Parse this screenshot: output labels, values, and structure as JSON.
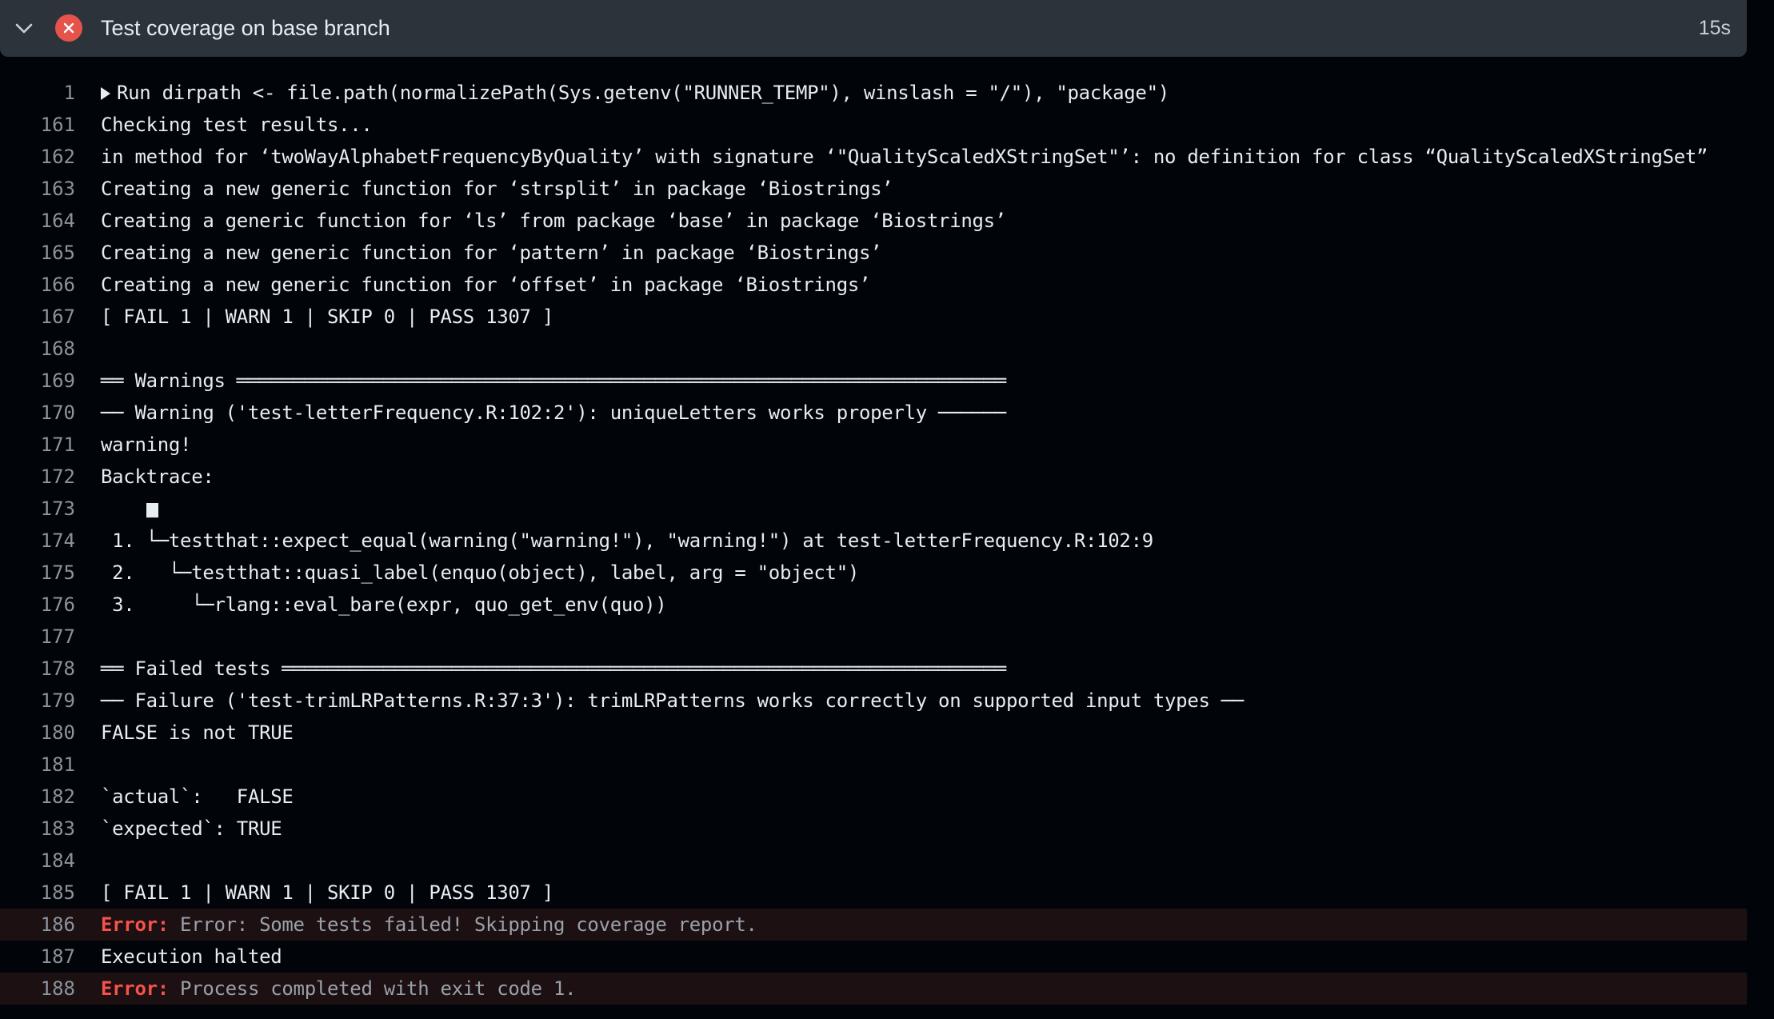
{
  "header": {
    "title": "Test coverage on base branch",
    "duration": "15s",
    "status": "failed",
    "status_color": "#e5534b",
    "expand_icon": "chevron-down-icon",
    "status_icon": "x-circle-icon"
  },
  "log": {
    "lines": [
      {
        "num": "1",
        "text": "Run dirpath <- file.path(normalizePath(Sys.getenv(\"RUNNER_TEMP\"), winslash = \"/\"), \"package\")",
        "collapsible": true
      },
      {
        "num": "161",
        "text": "Checking test results..."
      },
      {
        "num": "162",
        "text": "in method for ‘twoWayAlphabetFrequencyByQuality’ with signature ‘\"QualityScaledXStringSet\"’: no definition for class “QualityScaledXStringSet”"
      },
      {
        "num": "163",
        "text": "Creating a new generic function for ‘strsplit’ in package ‘Biostrings’"
      },
      {
        "num": "164",
        "text": "Creating a generic function for ‘ls’ from package ‘base’ in package ‘Biostrings’"
      },
      {
        "num": "165",
        "text": "Creating a new generic function for ‘pattern’ in package ‘Biostrings’"
      },
      {
        "num": "166",
        "text": "Creating a new generic function for ‘offset’ in package ‘Biostrings’"
      },
      {
        "num": "167",
        "text": "[ FAIL 1 | WARN 1 | SKIP 0 | PASS 1307 ]"
      },
      {
        "num": "168",
        "text": ""
      },
      {
        "num": "169",
        "text": "══ Warnings ════════════════════════════════════════════════════════════════════"
      },
      {
        "num": "170",
        "text": "── Warning ('test-letterFrequency.R:102:2'): uniqueLetters works properly ──────"
      },
      {
        "num": "171",
        "text": "warning!"
      },
      {
        "num": "172",
        "text": "Backtrace:"
      },
      {
        "num": "173",
        "text": "",
        "block": true
      },
      {
        "num": "174",
        "text": " 1. └─testthat::expect_equal(warning(\"warning!\"), \"warning!\") at test-letterFrequency.R:102:9"
      },
      {
        "num": "175",
        "text": " 2.   └─testthat::quasi_label(enquo(object), label, arg = \"object\")"
      },
      {
        "num": "176",
        "text": " 3.     └─rlang::eval_bare(expr, quo_get_env(quo))"
      },
      {
        "num": "177",
        "text": ""
      },
      {
        "num": "178",
        "text": "══ Failed tests ════════════════════════════════════════════════════════════════"
      },
      {
        "num": "179",
        "text": "── Failure ('test-trimLRPatterns.R:37:3'): trimLRPatterns works correctly on supported input types ──"
      },
      {
        "num": "180",
        "text": "FALSE is not TRUE"
      },
      {
        "num": "181",
        "text": ""
      },
      {
        "num": "182",
        "text": "`actual`:   FALSE"
      },
      {
        "num": "183",
        "text": "`expected`: TRUE "
      },
      {
        "num": "184",
        "text": ""
      },
      {
        "num": "185",
        "text": "[ FAIL 1 | WARN 1 | SKIP 0 | PASS 1307 ]"
      },
      {
        "num": "186",
        "label": "Error:",
        "text": " Error: Some tests failed! Skipping coverage report.",
        "error": true
      },
      {
        "num": "187",
        "text": "Execution halted"
      },
      {
        "num": "188",
        "label": "Error:",
        "text": " Process completed with exit code 1.",
        "error": true
      }
    ]
  },
  "colors": {
    "background": "#010409",
    "header_bg": "#2d333b",
    "error_label": "#f85149",
    "error_row_bg": "#1c1012",
    "line_number": "#8b949e",
    "text": "#e6edf3"
  }
}
